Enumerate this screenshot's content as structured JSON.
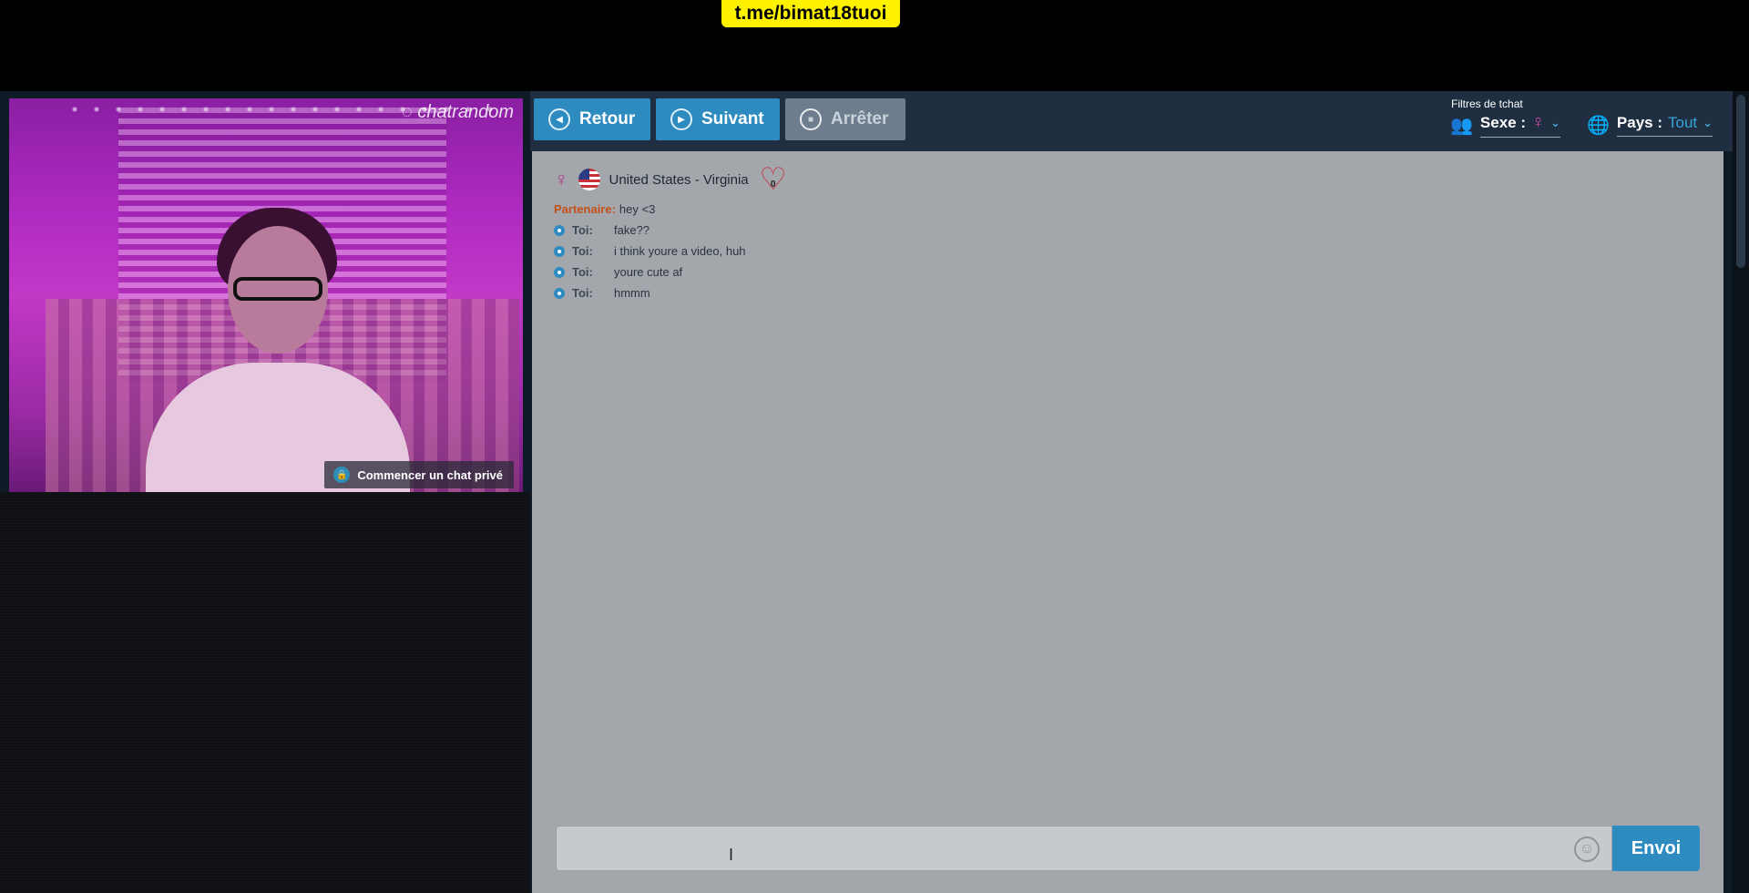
{
  "overlay": {
    "watermark": "t.me/bimat18tuoi"
  },
  "video": {
    "logo": "chatrandom",
    "private_chat_label": "Commencer un chat privé"
  },
  "toolbar": {
    "back_label": "Retour",
    "next_label": "Suivant",
    "stop_label": "Arrêter",
    "filters_label": "Filtres de tchat",
    "sex_label": "Sexe :",
    "country_label": "Pays :",
    "country_value": "Tout"
  },
  "partner": {
    "location": "United States - Virginia",
    "likes": "0"
  },
  "messages": {
    "partner_label": "Partenaire:",
    "partner_text": "hey <3",
    "you_label": "Toi:",
    "you_texts": [
      "fake??",
      "i think youre a video, huh",
      "youre cute af",
      "hmmm"
    ]
  },
  "composer": {
    "input_value": "",
    "send_label": "Envoi"
  },
  "icons": {
    "back": "back-icon",
    "next": "play-icon",
    "stop": "stop-icon",
    "people": "people-icon",
    "globe": "globe-icon",
    "emoji": "emoji-icon",
    "heart": "heart-icon",
    "lock": "lock-icon"
  },
  "colors": {
    "primary_button": "#2d8bc0",
    "disabled_button": "#6e7d8e",
    "toolbar_bg": "#1f2e40",
    "chat_bg": "#a3a6aa",
    "partner_name": "#c4511a",
    "watermark_bg": "#fff200"
  }
}
